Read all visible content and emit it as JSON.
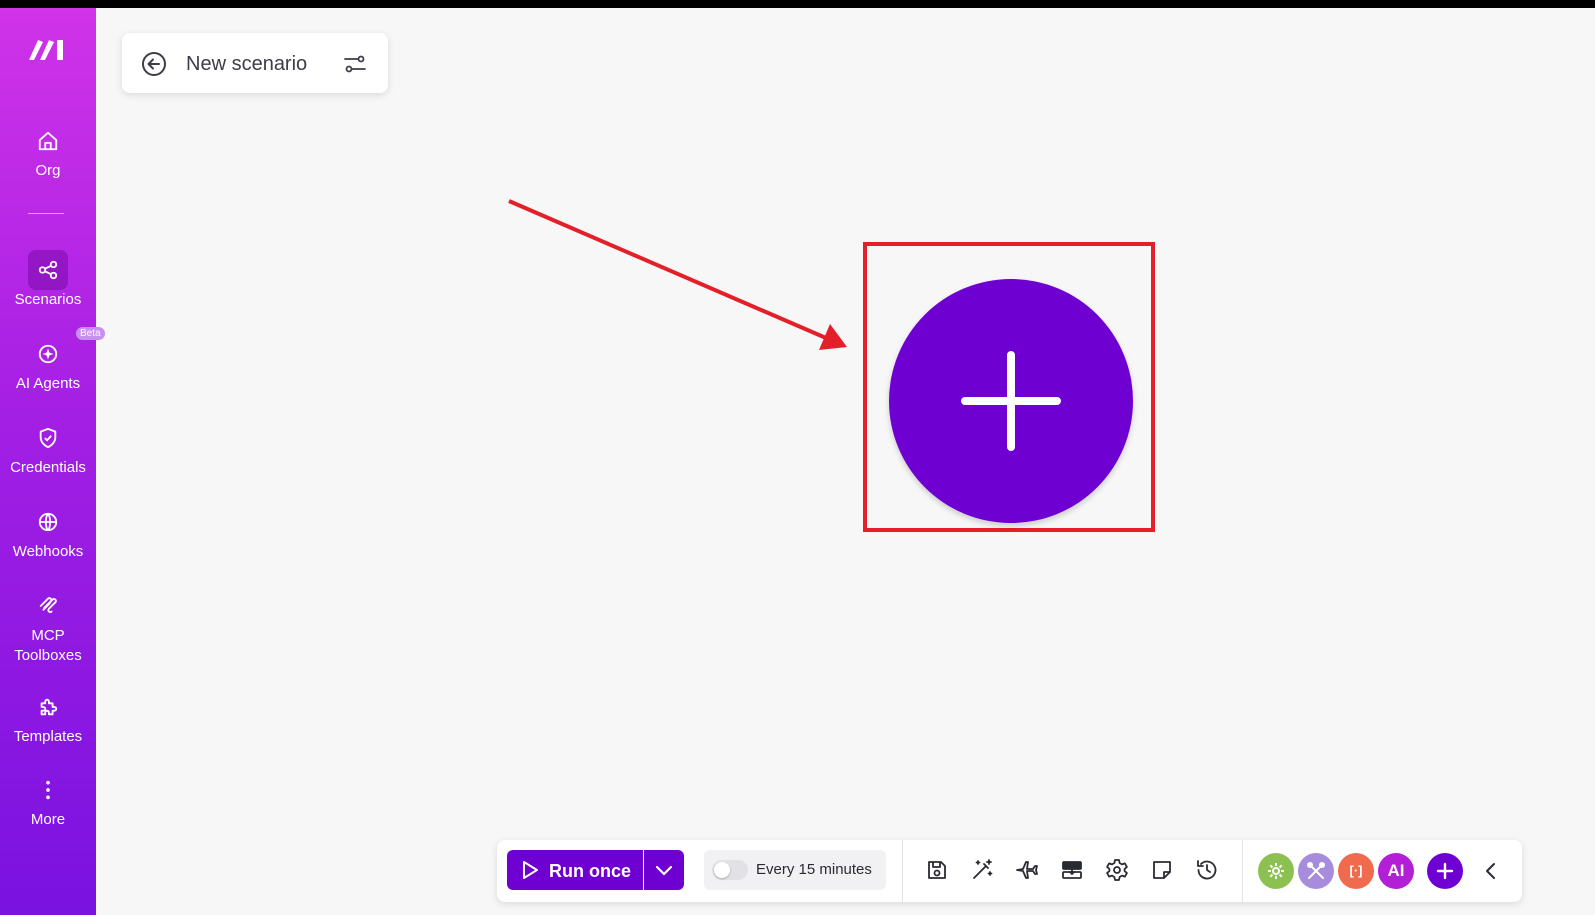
{
  "app": {
    "name": "Make",
    "logo_icon": "make-logo-icon"
  },
  "sidebar": {
    "items": [
      {
        "label": "Org",
        "icon": "home-icon"
      },
      {
        "label": "Scenarios",
        "icon": "share-nodes-icon",
        "active": true
      },
      {
        "label": "AI Agents",
        "icon": "sparkle-icon",
        "badge": "Beta"
      },
      {
        "label": "Credentials",
        "icon": "shield-check-icon"
      },
      {
        "label": "Webhooks",
        "icon": "globe-icon"
      },
      {
        "label": "MCP\nToolboxes",
        "icon": "mcp-icon"
      },
      {
        "label": "Templates",
        "icon": "puzzle-icon"
      },
      {
        "label": "More",
        "icon": "vertical-dots-icon"
      }
    ]
  },
  "scenario": {
    "title": "New scenario",
    "back_icon": "arrow-left-circle-icon",
    "settings_icon": "sliders-icon"
  },
  "canvas": {
    "add_module_icon": "plus-icon",
    "annotation": {
      "arrow_color": "#e3202a",
      "box_color": "#e3202a"
    }
  },
  "toolbar": {
    "run_label": "Run once",
    "run_icon": "play-icon",
    "run_dropdown_icon": "chevron-down-icon",
    "schedule_label": "Every 15 minutes",
    "schedule_enabled": false,
    "tools": [
      {
        "name": "save-icon"
      },
      {
        "name": "magic-wand-icon"
      },
      {
        "name": "airplane-icon"
      },
      {
        "name": "flow-control-icon"
      },
      {
        "name": "gear-icon"
      },
      {
        "name": "note-icon"
      },
      {
        "name": "history-icon"
      }
    ],
    "chips": [
      {
        "name": "tools-chip",
        "color": "#8cc152"
      },
      {
        "name": "flow-chip",
        "color": "#a78bdc"
      },
      {
        "name": "text-parser-chip",
        "color": "#f06a4e",
        "text": "[·]"
      },
      {
        "name": "ai-chip",
        "color": "#b21fd6",
        "text": "AI"
      },
      {
        "name": "add-chip",
        "color": "#6e00d1"
      }
    ],
    "collapse_icon": "chevron-left-icon"
  },
  "colors": {
    "brand_purple": "#6e00d1",
    "sidebar_top": "#d033e8",
    "sidebar_bottom": "#7a12e0"
  }
}
